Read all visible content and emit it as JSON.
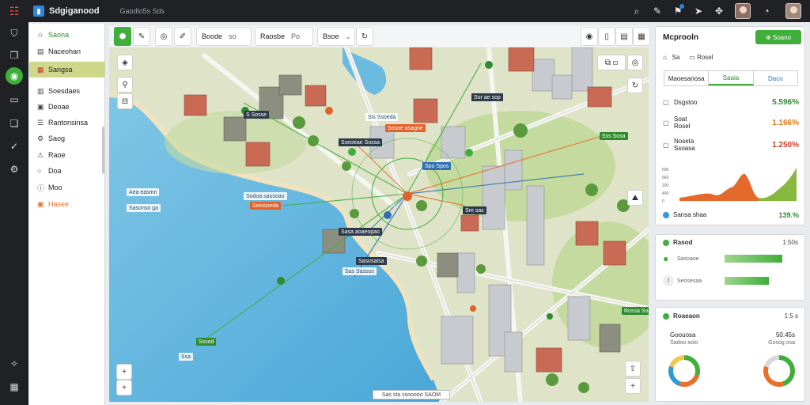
{
  "topbar": {
    "app_title": "Sdgiganood",
    "breadcrumb": "Gaodlo5s  Sds",
    "icons": [
      "search-icon",
      "pin-icon",
      "notification-icon",
      "send-icon",
      "puzzle-icon",
      "help-icon"
    ]
  },
  "rail": {
    "icons": [
      "shield-icon",
      "box-icon",
      "globe-icon",
      "display-icon",
      "package-icon",
      "check-icon",
      "settings-icon",
      "magic-icon",
      "building-icon"
    ]
  },
  "menu": {
    "items": [
      {
        "label": "Saona",
        "icon": "star-icon"
      },
      {
        "label": "Naceohan",
        "icon": "list-icon"
      },
      {
        "label": "Sangsa",
        "icon": "layers-icon"
      },
      {
        "label": "Soesdaes",
        "icon": "calendar-icon"
      },
      {
        "label": "Deoae",
        "icon": "note-icon"
      },
      {
        "label": "Rantonsinsa",
        "icon": "list-icon"
      },
      {
        "label": "Saog",
        "icon": "gear-icon"
      },
      {
        "label": "Raoe",
        "icon": "alert-icon"
      },
      {
        "label": "Doa",
        "icon": "circle-icon"
      },
      {
        "label": "Moo",
        "icon": "info-icon"
      },
      {
        "label": "Hasee",
        "icon": "warning-icon"
      }
    ]
  },
  "map_toolbar": {
    "group1": {
      "label": "Boode",
      "sub": "so"
    },
    "group2": {
      "label": "Raosbe",
      "sub": "Po"
    },
    "group3": {
      "label": "Bsoe"
    }
  },
  "map": {
    "callouts": [
      "Sor ae sop",
      "Sis Ssoeda",
      "Sosoe asagne",
      "S Sosse",
      "Sseoeae Sossa",
      "Sss Sosa",
      "Sodoa saosoao",
      "Seiosoeda",
      "Spo Spos",
      "Sre sas",
      "Sasa aoaeopao",
      "Sasosatsa",
      "Sas Sassos",
      "Aea easmn",
      "Sasonso ga",
      "Sssod",
      "Ssa",
      "Rossa Soaoea"
    ],
    "scale_label": "Sas sta ssooooo  SAOM"
  },
  "panel_main": {
    "title": "Mcprooln",
    "add_button": "Soano",
    "sub_row": {
      "a": "Sa",
      "b": "Rosel"
    },
    "tabs": [
      "Maoesanosa",
      "Saaia",
      "Daco"
    ],
    "stats": [
      {
        "label": "Dsgstoo",
        "value": "5.596%",
        "color": "green",
        "icon": "clipboard-icon"
      },
      {
        "label": "Soat Rosel",
        "value": "1.166%",
        "color": "orange",
        "icon": "file-icon"
      },
      {
        "label": "Noseta Ssoasa",
        "value": "1.250%",
        "color": "red",
        "icon": "clipboard-icon"
      }
    ],
    "chart_axis": [
      "600",
      "560",
      "200",
      "400",
      "0"
    ],
    "footer_label": "Sansa shaa",
    "footer_value": "139.%"
  },
  "panel_status": {
    "title": "Rasod",
    "value": "1:50s",
    "rows": [
      {
        "label": "Sasoaoe",
        "fill": 0.78
      },
      {
        "label": "Seosesaa",
        "fill": 0.6
      }
    ]
  },
  "panel_donuts": {
    "title": "Roaeaon",
    "value": "1:5 s",
    "left": {
      "title": "Goouosa",
      "sub": "Sadoo aolo"
    },
    "right": {
      "title": "50.45s",
      "sub": "Gosog osa"
    },
    "donut_left": [
      0.3,
      0.25,
      0.25,
      0.2
    ],
    "donut_right": [
      0.45,
      0.35,
      0.2
    ]
  },
  "colors": {
    "accent_green": "#3fae3a",
    "accent_orange": "#e8702a",
    "accent_blue": "#2f6fb1",
    "chrome": "#1f2124"
  }
}
